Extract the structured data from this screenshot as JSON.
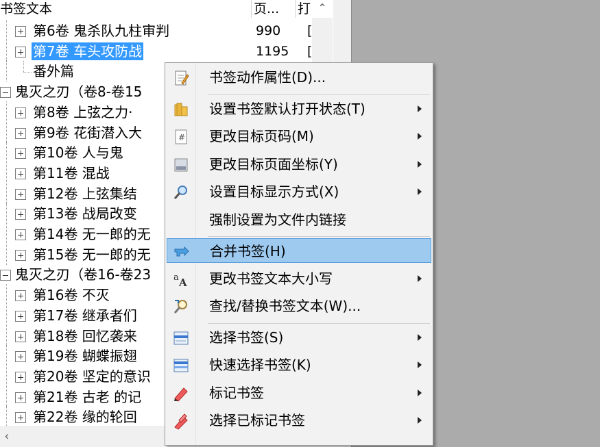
{
  "header": {
    "col_text": "书签文本",
    "col_page": "页...",
    "col_open": "打"
  },
  "tree": [
    {
      "label": "第6卷  鬼杀队九柱审判",
      "num": "990",
      "bracket": "[",
      "level": 1,
      "expander": "plus"
    },
    {
      "label": "第7卷  车头攻防战",
      "num": "1195",
      "bracket": "[",
      "level": 1,
      "expander": "plus",
      "selected": true
    },
    {
      "label": "番外篇",
      "num": "",
      "bracket": "",
      "level": 1,
      "expander": "none"
    },
    {
      "label": "鬼灭之刃（卷8-卷15",
      "num": "",
      "bracket": "",
      "level": 0,
      "expander": "minus"
    },
    {
      "label": "第8卷  上弦之力·",
      "num": "",
      "bracket": "",
      "level": 1,
      "expander": "plus"
    },
    {
      "label": "第9卷  花街潜入大",
      "num": "",
      "bracket": "",
      "level": 1,
      "expander": "plus"
    },
    {
      "label": "第10卷  人与鬼",
      "num": "",
      "bracket": "",
      "level": 1,
      "expander": "plus"
    },
    {
      "label": "第11卷  混战",
      "num": "",
      "bracket": "",
      "level": 1,
      "expander": "plus"
    },
    {
      "label": "第12卷  上弦集结",
      "num": "",
      "bracket": "",
      "level": 1,
      "expander": "plus"
    },
    {
      "label": "第13卷  战局改变",
      "num": "",
      "bracket": "",
      "level": 1,
      "expander": "plus"
    },
    {
      "label": "第14卷  无一郎的无",
      "num": "",
      "bracket": "",
      "level": 1,
      "expander": "plus"
    },
    {
      "label": "第15卷  无一郎的无",
      "num": "",
      "bracket": "",
      "level": 1,
      "expander": "plus"
    },
    {
      "label": "鬼灭之刃（卷16-卷23",
      "num": "",
      "bracket": "",
      "level": 0,
      "expander": "minus"
    },
    {
      "label": "第16卷  不灭",
      "num": "",
      "bracket": "",
      "level": 1,
      "expander": "plus"
    },
    {
      "label": "第17卷  继承者们",
      "num": "",
      "bracket": "",
      "level": 1,
      "expander": "plus"
    },
    {
      "label": "第18卷  回忆袭来",
      "num": "",
      "bracket": "",
      "level": 1,
      "expander": "plus"
    },
    {
      "label": "第19卷  蝴蝶振翅",
      "num": "",
      "bracket": "",
      "level": 1,
      "expander": "plus"
    },
    {
      "label": "第20卷  坚定的意识",
      "num": "",
      "bracket": "",
      "level": 1,
      "expander": "plus"
    },
    {
      "label": "第21卷  古老 的记",
      "num": "",
      "bracket": "",
      "level": 1,
      "expander": "plus"
    },
    {
      "label": "第22卷  缘的轮回",
      "num": "",
      "bracket": "",
      "level": 1,
      "expander": "plus"
    }
  ],
  "menu": {
    "items": [
      {
        "name": "bookmark-action-properties",
        "label": "书签动作属性(D)...",
        "icon": "notepad-icon",
        "submenu": false
      },
      {
        "sep": true
      },
      {
        "name": "set-default-open-state",
        "label": "设置书签默认打开状态(T)",
        "icon": "folder-icon",
        "submenu": true
      },
      {
        "name": "change-target-page",
        "label": "更改目标页码(M)",
        "icon": "page-number-icon",
        "submenu": true
      },
      {
        "name": "change-target-coords",
        "label": "更改目标页面坐标(Y)",
        "icon": "page-coords-icon",
        "submenu": true
      },
      {
        "name": "set-target-display",
        "label": "设置目标显示方式(X)",
        "icon": "magnifier-icon",
        "submenu": true
      },
      {
        "name": "force-internal-link",
        "label": "强制设置为文件内链接",
        "icon": "",
        "submenu": false
      },
      {
        "sep": true
      },
      {
        "name": "merge-bookmarks",
        "label": "合并书签(H)",
        "icon": "merge-icon",
        "submenu": false,
        "highlighted": true
      },
      {
        "name": "change-case",
        "label": "更改书签文本大小写",
        "icon": "case-icon",
        "submenu": true
      },
      {
        "name": "find-replace",
        "label": "查找/替换书签文本(W)...",
        "icon": "find-replace-icon",
        "submenu": false
      },
      {
        "sep": true
      },
      {
        "name": "select-bookmarks",
        "label": "选择书签(S)",
        "icon": "select-list-icon",
        "submenu": true
      },
      {
        "name": "quick-select-bookmarks",
        "label": "快速选择书签(K)",
        "icon": "quick-select-icon",
        "submenu": true
      },
      {
        "name": "mark-bookmarks",
        "label": "标记书签",
        "icon": "marker-icon",
        "submenu": true
      },
      {
        "name": "select-marked-bookmarks",
        "label": "选择已标记书签",
        "icon": "marker-select-icon",
        "submenu": true
      }
    ]
  },
  "colors": {
    "selection": "#3399ff",
    "menu_highlight": "#9ecaf0",
    "menu_highlight_border": "#5aa0dc",
    "desktop": "#ababab"
  }
}
